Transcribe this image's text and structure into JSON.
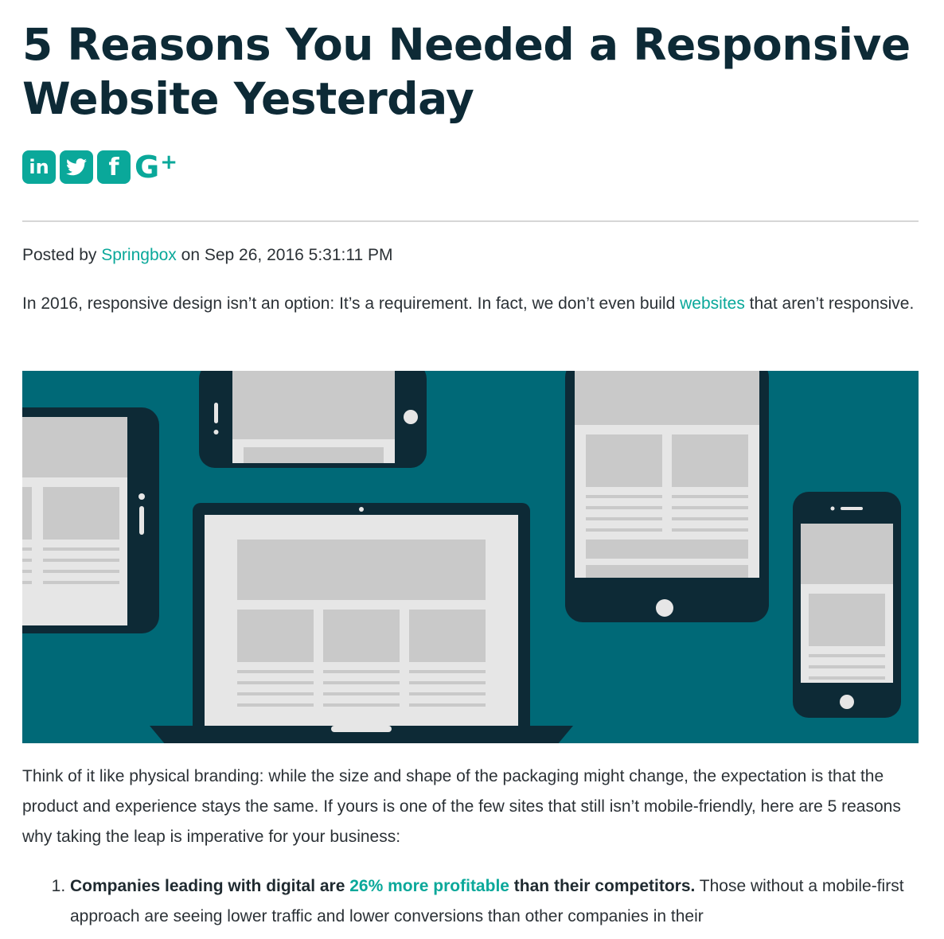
{
  "article": {
    "title": "5 Reasons You Needed a Responsive Website Yesterday",
    "social": {
      "linkedin_icon": "in",
      "twitter_icon": "twitter-bird",
      "facebook_icon": "f",
      "googleplus_icon": "G+"
    },
    "meta": {
      "posted_by": "Posted by",
      "author": "Springbox",
      "on": "on",
      "date": "Sep 26, 2016 5:31:11 PM"
    },
    "intro": {
      "before_link": "In 2016, responsive design isn’t an option: It’s a requirement. In fact, we don’t even build ",
      "link": "websites",
      "after_link": " that aren’t responsive."
    },
    "hero_image": {
      "accent": "#006977",
      "device_color": "#0d2a36"
    },
    "body_paragraph": "Think of it like physical branding: while the size and shape of the packaging might change, the expectation is that the product and experience stays the same. If yours is one of the few sites that still isn’t mobile-friendly, here are 5 reasons why taking the leap is imperative for your business:",
    "list": [
      {
        "bold_before": "Companies leading with digital are ",
        "bold_link": "26% more profitable",
        "bold_after": " than their competitors.",
        "rest": " Those without a mobile-first approach are seeing lower traffic and lower conversions than other companies in their"
      }
    ]
  },
  "colors": {
    "accent": "#0aa89a",
    "heading": "#0d2a36",
    "text": "#2b3136"
  }
}
